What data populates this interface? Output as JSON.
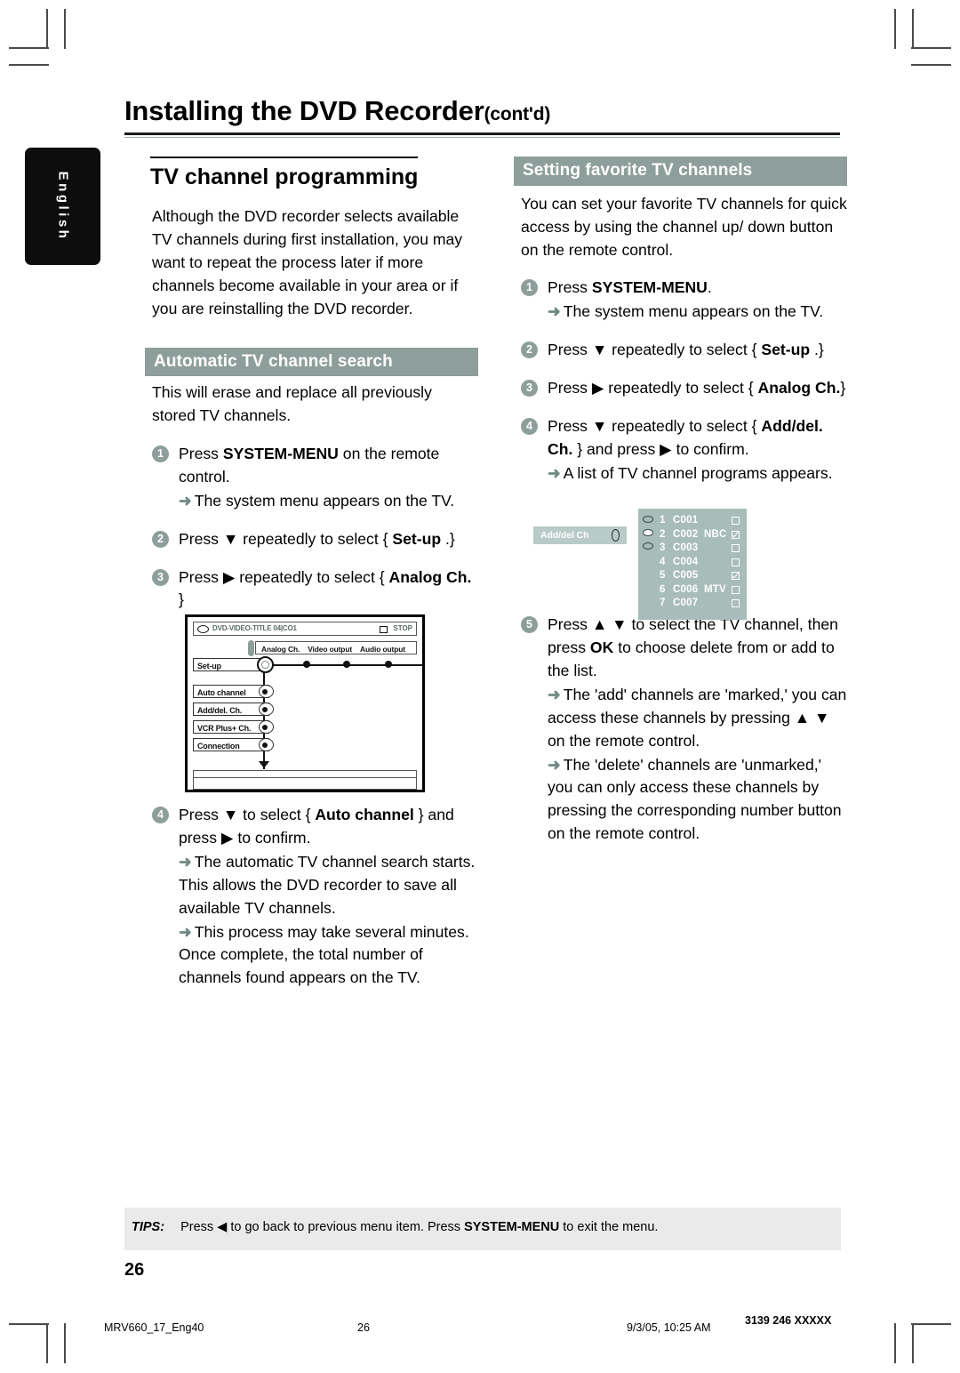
{
  "language_tab": "English",
  "header": {
    "title": "Installing the DVD Recorder",
    "contd": "(cont'd)"
  },
  "left_column": {
    "heading": "TV channel programming",
    "intro": "Although the DVD recorder selects available TV channels during first installation, you may want to repeat the process later if more channels become available in your area or if you are reinstalling the DVD recorder.",
    "section_bar": "Automatic  TV channel search",
    "section_intro": "This will erase and replace all previously stored TV channels.",
    "steps": [
      {
        "num": "1",
        "text_pre": "Press ",
        "bold": "SYSTEM-MENU",
        "text_post": " on the remote control.",
        "result": "The system menu appears on the TV."
      },
      {
        "num": "2",
        "text_pre": "Press ▼ repeatedly to select { ",
        "bold": "Set-up",
        "text_post": " .}",
        "result": ""
      },
      {
        "num": "3",
        "text_pre": "Press ▶ repeatedly to select { ",
        "bold": "Analog Ch.",
        "text_post": " }",
        "result": ""
      },
      {
        "num": "4",
        "text_pre": "Press ▼ to select { ",
        "bold": "Auto channel",
        "text_post": " } and press ▶ to confirm.",
        "result": "The automatic TV channel search starts. This allows the DVD recorder to save all available TV channels.",
        "result2": "This process may take several minutes. Once complete, the total number of channels found appears on the TV."
      }
    ]
  },
  "right_column": {
    "section_bar": "Setting favorite TV channels",
    "intro": "You can set your favorite TV channels for quick access by using the channel up/ down button on the remote control.",
    "steps": [
      {
        "num": "1",
        "text_pre": "Press ",
        "bold": "SYSTEM-MENU",
        "text_post": ".",
        "result": "The system menu appears on the TV."
      },
      {
        "num": "2",
        "text_pre": "Press ▼ repeatedly to select { ",
        "bold": "Set-up",
        "text_post": " .}",
        "result": ""
      },
      {
        "num": "3",
        "text_pre": "Press ▶ repeatedly to select { ",
        "bold": "Analog Ch.",
        "text_post": "}",
        "result": ""
      },
      {
        "num": "4",
        "text_pre": "Press ▼ repeatedly to select { ",
        "bold": "Add/del. Ch.",
        "text_post": " } and press ▶ to confirm.",
        "result": "A list of TV channel programs appears."
      },
      {
        "num": "5",
        "text_pre": "Press ▲ ▼ to select the TV channel, then press ",
        "bold": "OK",
        "text_post": " to choose delete from or add to the list.",
        "result": "The 'add' channels are 'marked,' you can access these channels by pressing ▲ ▼ on the remote control.",
        "result2": "The 'delete' channels are 'unmarked,' you can only access these channels by pressing the corresponding number button on the remote control."
      }
    ]
  },
  "tv_diagram": {
    "disc_label": "DVD-VIDEO-TITLE 04|CO1",
    "stop_label": "STOP",
    "tabs": [
      "Analog Ch.",
      "Video output",
      "Audio output"
    ],
    "menu_items": [
      "Set-up",
      "Auto channel",
      "Add/del. Ch.",
      "VCR Plus+ Ch.",
      "Connection"
    ]
  },
  "channel_list": {
    "tag_label": "Add/del Ch",
    "rows": [
      {
        "index": "1",
        "code": "C001",
        "network": "",
        "checked": false
      },
      {
        "index": "2",
        "code": "C002",
        "network": "NBC",
        "checked": true
      },
      {
        "index": "3",
        "code": "C003",
        "network": "",
        "checked": false
      },
      {
        "index": "4",
        "code": "C004",
        "network": "",
        "checked": false
      },
      {
        "index": "5",
        "code": "C005",
        "network": "",
        "checked": true
      },
      {
        "index": "6",
        "code": "C006",
        "network": "MTV",
        "checked": false
      },
      {
        "index": "7",
        "code": "C007",
        "network": "",
        "checked": false
      }
    ]
  },
  "tips": {
    "label": "TIPS:",
    "text_pre": "Press ◀ to go back to previous menu item.  Press ",
    "bold": "SYSTEM-MENU",
    "text_post": " to exit the menu."
  },
  "page_number": "26",
  "footer": {
    "file": "MRV660_17_Eng40",
    "page": "26",
    "date": "9/3/05, 10:25 AM",
    "code": "3139 246 XXXXX"
  },
  "colors": {
    "accent_bar": "#8e9f9b",
    "panel": "#a8bdb9",
    "tag": "#b9cbc7",
    "tips_bg": "#eaeaea"
  }
}
